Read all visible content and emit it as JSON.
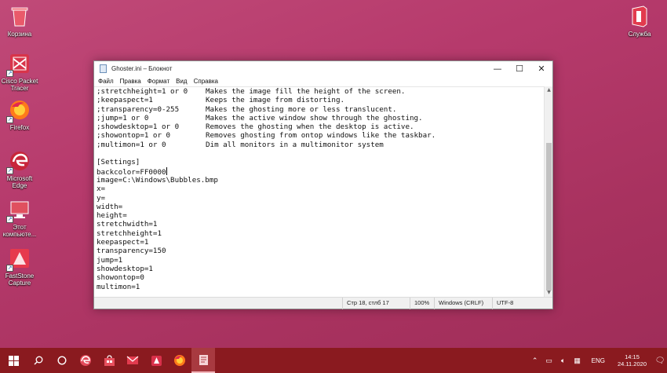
{
  "desktop": {
    "icons": [
      {
        "label": "Корзина"
      },
      {
        "label": "Cisco Packet Tracer"
      },
      {
        "label": "Firefox"
      },
      {
        "label": "Microsoft Edge"
      },
      {
        "label": "Этот компьюте..."
      },
      {
        "label": "FastStone Capture"
      },
      {
        "label": "Служба"
      }
    ]
  },
  "window": {
    "title": "Ghoster.ini – Блокнот",
    "controls": {
      "minimize": "—",
      "maximize": "☐",
      "close": "✕"
    },
    "menu": [
      "Файл",
      "Правка",
      "Формат",
      "Вид",
      "Справка"
    ]
  },
  "editor": {
    "comment_lines": [
      {
        "key": ";stretchheight=1 or 0",
        "desc": "Makes the image fill the height of the screen."
      },
      {
        "key": ";keepaspect=1",
        "desc": "Keeps the image from distorting."
      },
      {
        "key": ";transparency=0-255",
        "desc": "Makes the ghosting more or less translucent."
      },
      {
        "key": ";jump=1 or 0",
        "desc": "Makes the active window show through the ghosting."
      },
      {
        "key": ";showdesktop=1 or 0",
        "desc": "Removes the ghosting when the desktop is active."
      },
      {
        "key": ";showontop=1 or 0",
        "desc": "Removes ghosting from ontop windows like the taskbar."
      },
      {
        "key": ";multimon=1 or 0",
        "desc": "Dim all monitors in a multimonitor system"
      }
    ],
    "section": "[Settings]",
    "settings": [
      "backcolor=FF0000",
      "image=C:\\Windows\\Bubbles.bmp",
      "x=",
      "y=",
      "width=",
      "height=",
      "stretchwidth=1",
      "stretchheight=1",
      "keepaspect=1",
      "transparency=150",
      "jump=1",
      "showdesktop=1",
      "showontop=0",
      "multimon=1"
    ]
  },
  "status": {
    "position": "Стр 18, стлб 17",
    "zoom": "100%",
    "line_endings": "Windows (CRLF)",
    "encoding": "UTF-8"
  },
  "taskbar": {
    "items": [
      "windows-start-icon",
      "search-icon",
      "cortana-icon",
      "edge-icon",
      "store-icon",
      "mail-icon",
      "app-icon",
      "firefox-icon",
      "notepad-icon"
    ],
    "language": "ENG",
    "time": "14:15",
    "date": "24.11.2020"
  },
  "colors": {
    "taskbar": "#8a1a1f",
    "desktop": "#b63a6c"
  }
}
